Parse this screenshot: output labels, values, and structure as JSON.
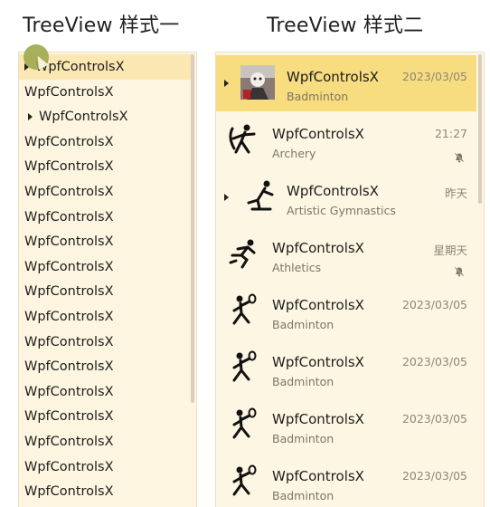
{
  "headings": {
    "style1": "TreeView 样式一",
    "style2": "TreeView 样式二"
  },
  "tree1": {
    "items": [
      {
        "label": "WpfControlsX",
        "expander": true,
        "selected": true
      },
      {
        "label": "WpfControlsX",
        "expander": false
      },
      {
        "label": "WpfControlsX",
        "expander": true,
        "indented": true
      },
      {
        "label": "WpfControlsX",
        "expander": false
      },
      {
        "label": "WpfControlsX",
        "expander": false
      },
      {
        "label": "WpfControlsX",
        "expander": false
      },
      {
        "label": "WpfControlsX",
        "expander": false
      },
      {
        "label": "WpfControlsX",
        "expander": false
      },
      {
        "label": "WpfControlsX",
        "expander": false
      },
      {
        "label": "WpfControlsX",
        "expander": false
      },
      {
        "label": "WpfControlsX",
        "expander": false
      },
      {
        "label": "WpfControlsX",
        "expander": false
      },
      {
        "label": "WpfControlsX",
        "expander": false
      },
      {
        "label": "WpfControlsX",
        "expander": false
      },
      {
        "label": "WpfControlsX",
        "expander": false
      },
      {
        "label": "WpfControlsX",
        "expander": false
      },
      {
        "label": "WpfControlsX",
        "expander": false
      },
      {
        "label": "WpfControlsX",
        "expander": false
      }
    ]
  },
  "tree2": {
    "items": [
      {
        "title": "WpfControlsX",
        "subtitle": "Badminton",
        "time": "2023/03/05",
        "icon": "avatar-photo-icon",
        "expander": true,
        "selected": true,
        "muted": false
      },
      {
        "title": "WpfControlsX",
        "subtitle": "Archery",
        "time": "21:27",
        "icon": "archery-icon",
        "expander": false,
        "muted": true
      },
      {
        "title": "WpfControlsX",
        "subtitle": "Artistic Gymnastics",
        "time": "昨天",
        "icon": "gymnastics-icon",
        "expander": true,
        "muted": false
      },
      {
        "title": "WpfControlsX",
        "subtitle": "Athletics",
        "time": "星期天",
        "icon": "athletics-icon",
        "expander": false,
        "muted": true
      },
      {
        "title": "WpfControlsX",
        "subtitle": "Badminton",
        "time": "2023/03/05",
        "icon": "badminton-icon",
        "expander": false,
        "muted": false
      },
      {
        "title": "WpfControlsX",
        "subtitle": "Badminton",
        "time": "2023/03/05",
        "icon": "badminton-icon",
        "expander": false,
        "muted": false
      },
      {
        "title": "WpfControlsX",
        "subtitle": "Badminton",
        "time": "2023/03/05",
        "icon": "badminton-icon",
        "expander": false,
        "muted": false
      },
      {
        "title": "WpfControlsX",
        "subtitle": "Badminton",
        "time": "2023/03/05",
        "icon": "badminton-icon",
        "expander": false,
        "muted": false
      }
    ]
  },
  "colors": {
    "selected1": "#fbe7b2",
    "selected2": "#f7dc80",
    "panel_bg": "#fdf5df",
    "accent": "#9fa94f"
  }
}
